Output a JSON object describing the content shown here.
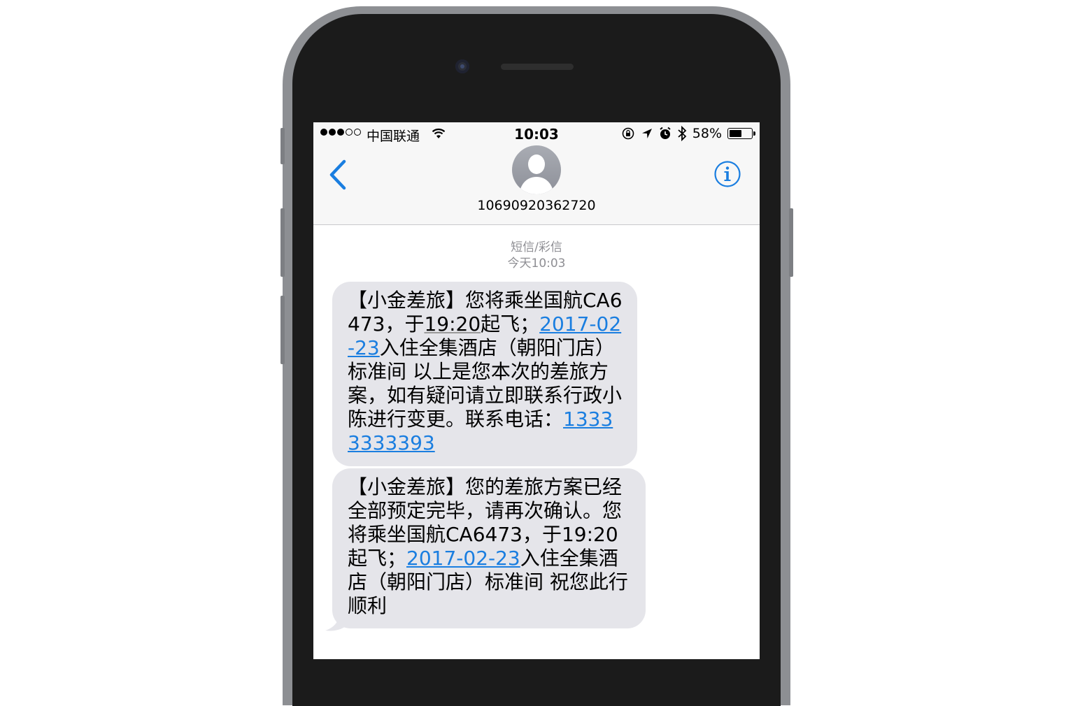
{
  "status_bar": {
    "carrier": "中国联通",
    "time": "10:03",
    "battery": "58%",
    "battery_level": 0.58
  },
  "nav": {
    "contact_number": "10690920362720"
  },
  "conversation": {
    "channel": "短信/彩信",
    "timestamp": "今天10:03"
  },
  "messages": [
    {
      "part1": "【小金差旅】您将乘坐国航CA6473，于",
      "time_link": "19:20",
      "part2": "起飞；",
      "date_link": "2017-02-23",
      "part3": "入住全集酒店（朝阳门店）标准间 以上是您本次的差旅方案，如有疑问请立即联系行政小陈进行变更。联系电话：",
      "phone_link": "13333333393"
    },
    {
      "part1": "【小金差旅】您的差旅方案已经全部预定完毕，请再次确认。您将乘坐国航CA6473，于19:20起飞；",
      "date_link": "2017-02-23",
      "part2": "入住全集酒店（朝阳门店）标准间  祝您此行顺利"
    }
  ],
  "icons": [
    "back-chevron-icon",
    "info-icon",
    "wifi-icon",
    "orientation-lock-icon",
    "location-arrow-icon",
    "alarm-icon",
    "bluetooth-icon",
    "battery-icon",
    "contact-avatar-icon"
  ],
  "colors": {
    "accent": "#1a7ee0",
    "bubble": "#e5e5ea",
    "meta_text": "#8e8e93"
  }
}
